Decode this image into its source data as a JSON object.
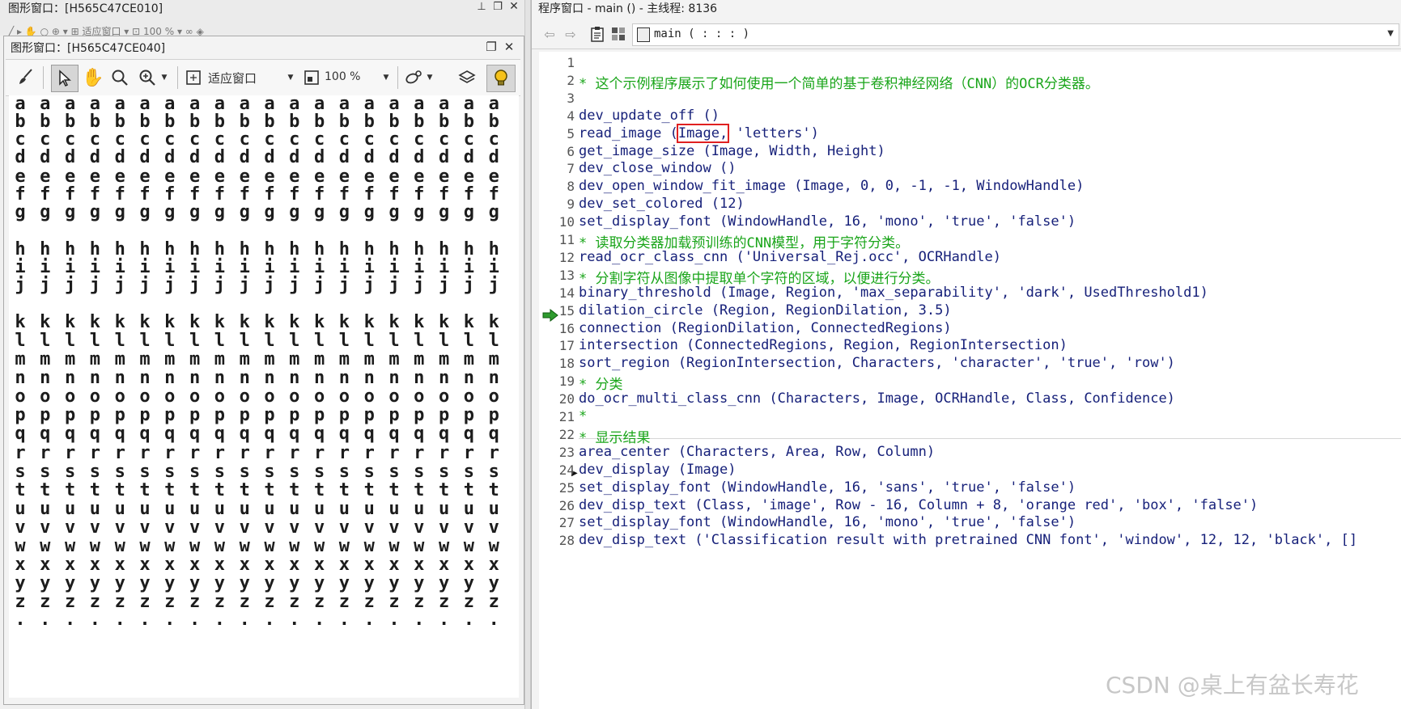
{
  "back_window": {
    "title": "图形窗口：[H565C47CE010]"
  },
  "graphics_window": {
    "title": "图形窗口：[H565C47CE040]",
    "toolbar": {
      "fit_label": "适应窗口",
      "zoom_label": "100 %"
    },
    "letter_rows": [
      {
        "ch": "a",
        "count": 20
      },
      {
        "ch": "b",
        "count": 20
      },
      {
        "ch": "c",
        "count": 20
      },
      {
        "ch": "d",
        "count": 20
      },
      {
        "ch": "e",
        "count": 20
      },
      {
        "ch": "f",
        "count": 20
      },
      {
        "ch": "g",
        "count": 20
      },
      {
        "ch": "h",
        "count": 20
      },
      {
        "ch": "i",
        "count": 20
      },
      {
        "ch": "j",
        "count": 20
      },
      {
        "ch": "k",
        "count": 20
      },
      {
        "ch": "l",
        "count": 20
      },
      {
        "ch": "m",
        "count": 20
      },
      {
        "ch": "n",
        "count": 20
      },
      {
        "ch": "o",
        "count": 20
      },
      {
        "ch": "p",
        "count": 20
      },
      {
        "ch": "q",
        "count": 20
      },
      {
        "ch": "r",
        "count": 20
      },
      {
        "ch": "s",
        "count": 20
      },
      {
        "ch": "t",
        "count": 20
      },
      {
        "ch": "u",
        "count": 20
      },
      {
        "ch": "v",
        "count": 20
      },
      {
        "ch": "w",
        "count": 20
      },
      {
        "ch": "x",
        "count": 20
      },
      {
        "ch": "y",
        "count": 20
      },
      {
        "ch": "z",
        "count": 20
      },
      {
        "ch": ".",
        "count": 20
      }
    ]
  },
  "program_window": {
    "title": "程序窗口 - main () - 主线程: 8136",
    "procedure_selector": "main ( : : : )",
    "lines": [
      {
        "num": "1",
        "text": "",
        "type": "proc"
      },
      {
        "num": "2",
        "text": "* 这个示例程序展示了如何使用一个简单的基于卷积神经网络（CNN）的OCR分类器。",
        "type": "cmt"
      },
      {
        "num": "3",
        "text": "",
        "type": "proc"
      },
      {
        "num": "4",
        "text": "dev_update_off ()",
        "type": "proc"
      },
      {
        "num": "5",
        "text": "read_image ",
        "highlight": "Image,",
        "rest": " 'letters')",
        "lead": "(",
        "type": "proc"
      },
      {
        "num": "6",
        "text": "get_image_size (Image, Width, Height)",
        "type": "proc"
      },
      {
        "num": "7",
        "text": "dev_close_window ()",
        "type": "proc"
      },
      {
        "num": "8",
        "text": "dev_open_window_fit_image (Image, 0, 0, -1, -1, WindowHandle)",
        "type": "proc"
      },
      {
        "num": "9",
        "text": "dev_set_colored (12)",
        "type": "proc"
      },
      {
        "num": "10",
        "text": "set_display_font (WindowHandle, 16, 'mono', 'true', 'false')",
        "type": "proc"
      },
      {
        "num": "11",
        "text": "* 读取分类器加载预训练的CNN模型，用于字符分类。",
        "type": "cmt"
      },
      {
        "num": "12",
        "text": "read_ocr_class_cnn ('Universal_Rej.occ', OCRHandle)",
        "type": "proc"
      },
      {
        "num": "13",
        "text": "* 分割字符从图像中提取单个字符的区域，以便进行分类。",
        "type": "cmt"
      },
      {
        "num": "14",
        "text": "binary_threshold (Image, Region, 'max_separability', 'dark', UsedThreshold1)",
        "type": "proc",
        "current": true
      },
      {
        "num": "15",
        "text": "dilation_circle (Region, RegionDilation, 3.5)",
        "type": "proc"
      },
      {
        "num": "16",
        "text": "connection (RegionDilation, ConnectedRegions)",
        "type": "proc"
      },
      {
        "num": "17",
        "text": "intersection (ConnectedRegions, Region, RegionIntersection)",
        "type": "proc"
      },
      {
        "num": "18",
        "text": "sort_region (RegionIntersection, Characters, 'character', 'true', 'row')",
        "type": "proc"
      },
      {
        "num": "19",
        "text": "* 分类",
        "type": "cmt"
      },
      {
        "num": "20",
        "text": "do_ocr_multi_class_cnn (Characters, Image, OCRHandle, Class, Confidence)",
        "type": "proc"
      },
      {
        "num": "21",
        "text": "*",
        "type": "cmt"
      },
      {
        "num": "22",
        "text": "* 显示结果",
        "type": "cmt"
      },
      {
        "num": "23",
        "text": "area_center (Characters, Area, Row, Column)",
        "type": "proc"
      },
      {
        "num": "24",
        "text": "dev_display (Image)",
        "type": "proc"
      },
      {
        "num": "25",
        "text": "set_display_font (WindowHandle, 16, 'sans', 'true', 'false')",
        "type": "proc"
      },
      {
        "num": "26",
        "text": "dev_disp_text (Class, 'image', Row - 16, Column + 8, 'orange red', 'box', 'false')",
        "type": "proc"
      },
      {
        "num": "27",
        "text": "set_display_font (WindowHandle, 16, 'mono', 'true', 'false')",
        "type": "proc"
      },
      {
        "num": "28",
        "text": "dev_disp_text ('Classification result with pretrained CNN font', 'window', 12, 12, 'black', []",
        "type": "proc"
      }
    ]
  },
  "watermark": "CSDN @桌上有盆长寿花",
  "colors": {
    "procedure": "#17217a",
    "comment": "#1aa51a",
    "highlight_box": "#e02020"
  }
}
